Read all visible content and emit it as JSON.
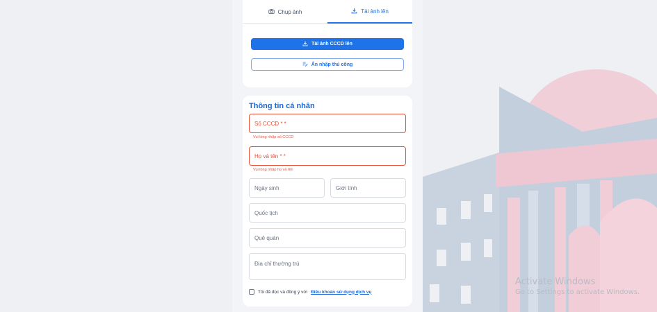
{
  "tabs": [
    {
      "label": "Chụp ảnh",
      "icon": "camera-icon"
    },
    {
      "label": "Tải ảnh lên",
      "icon": "download-icon",
      "active": true
    }
  ],
  "actions": {
    "upload_cccd": "Tải ảnh CCCD lên",
    "manual_entry": "Ấn nhập thủ công"
  },
  "form": {
    "title": "Thông tin cá nhân",
    "cccd": {
      "placeholder": "Số CCCD * *",
      "error": "Vui lòng nhập số CCCD"
    },
    "full_name": {
      "placeholder": "Họ và tên * *",
      "error": "Vui lòng nhập họ và tên"
    },
    "birth_date": {
      "placeholder": "Ngày sinh"
    },
    "gender": {
      "placeholder": "Giới tính"
    },
    "nationality": {
      "placeholder": "Quốc tịch"
    },
    "hometown": {
      "placeholder": "Quê quán"
    },
    "address": {
      "placeholder": "Địa chỉ thường trú"
    },
    "agreement": {
      "text": "Tôi đã đọc và đồng ý với",
      "link": "Điều khoản sử dụng dịch vụ"
    }
  },
  "watermark": {
    "line1": "Activate Windows",
    "line2": "Go to Settings to activate Windows."
  },
  "colors": {
    "accent": "#1e73e8",
    "error": "#e5533b"
  }
}
